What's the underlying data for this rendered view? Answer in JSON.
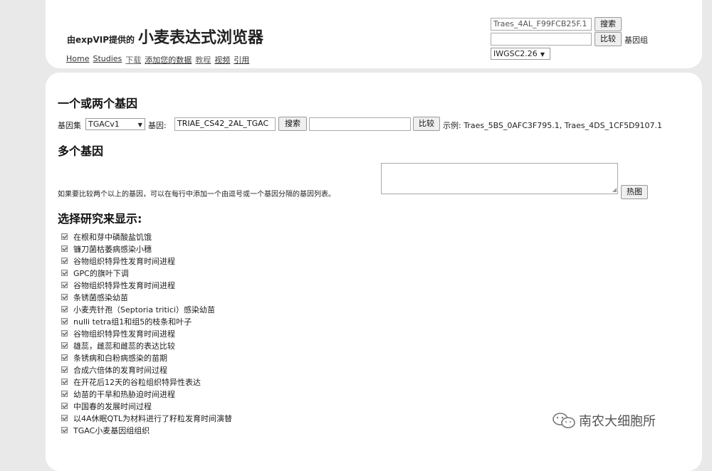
{
  "header": {
    "brand_pre": "由expVIP提供的",
    "brand_title": "小麦表达式浏览器",
    "nav": [
      "Home",
      "Studies",
      "下载",
      "添加您的数据",
      "教程",
      "视频",
      "引用"
    ],
    "search_value": "Traes_4AL_F99FCB25F.1",
    "search_button": "搜索",
    "compare_value": "",
    "compare_button": "比较",
    "genome_label": "基因组",
    "genome_select": "IWGSC2.26"
  },
  "main": {
    "section1_title": "一个或两个基因",
    "geneset_label": "基因集",
    "geneset_select": "TGACv1",
    "gene_label": "基因:",
    "gene_value": "TRIAE_CS42_2AL_TGAC",
    "search_button": "搜索",
    "compare_value": "",
    "compare_button": "比较",
    "example_text": "示例: Traes_5BS_0AFC3F795.1, Traes_4DS_1CF5D9107.1",
    "section2_title": "多个基因",
    "multi_desc": "如果要比较两个以上的基因，可以在每行中添加一个由逗号或一个基因分隔的基因列表。",
    "heatmap_button": "热图",
    "section3_title": "选择研究来显示:",
    "studies": [
      "在根和芽中磷酸盐饥饿",
      "镰刀菌枯萎病感染小穗",
      "谷物组织特异性发育时间进程",
      "GPC的旗叶下调",
      "谷物组织特异性发育时间进程",
      "条锈菌感染幼苗",
      "小麦壳针孢（Septoria tritici）感染幼苗",
      "nulli tetra组1和组5的枝条和叶子",
      "谷物组织特异性发育时间进程",
      "雄蕊，雌蕊和雌蕊的表达比较",
      "条锈病和白粉病感染的苗期",
      "合成六倍体的发育时间过程",
      "在开花后12天的谷粒组织特异性表达",
      "幼苗的干旱和热胁迫时间进程",
      "中国春的发展时间过程",
      "以4A休眠QTL为材料进行了籽粒发育时间演替",
      "TGAC小麦基因组组织"
    ]
  },
  "watermark": {
    "text": "南农大细胞所",
    "icon": "wechat-icon"
  }
}
